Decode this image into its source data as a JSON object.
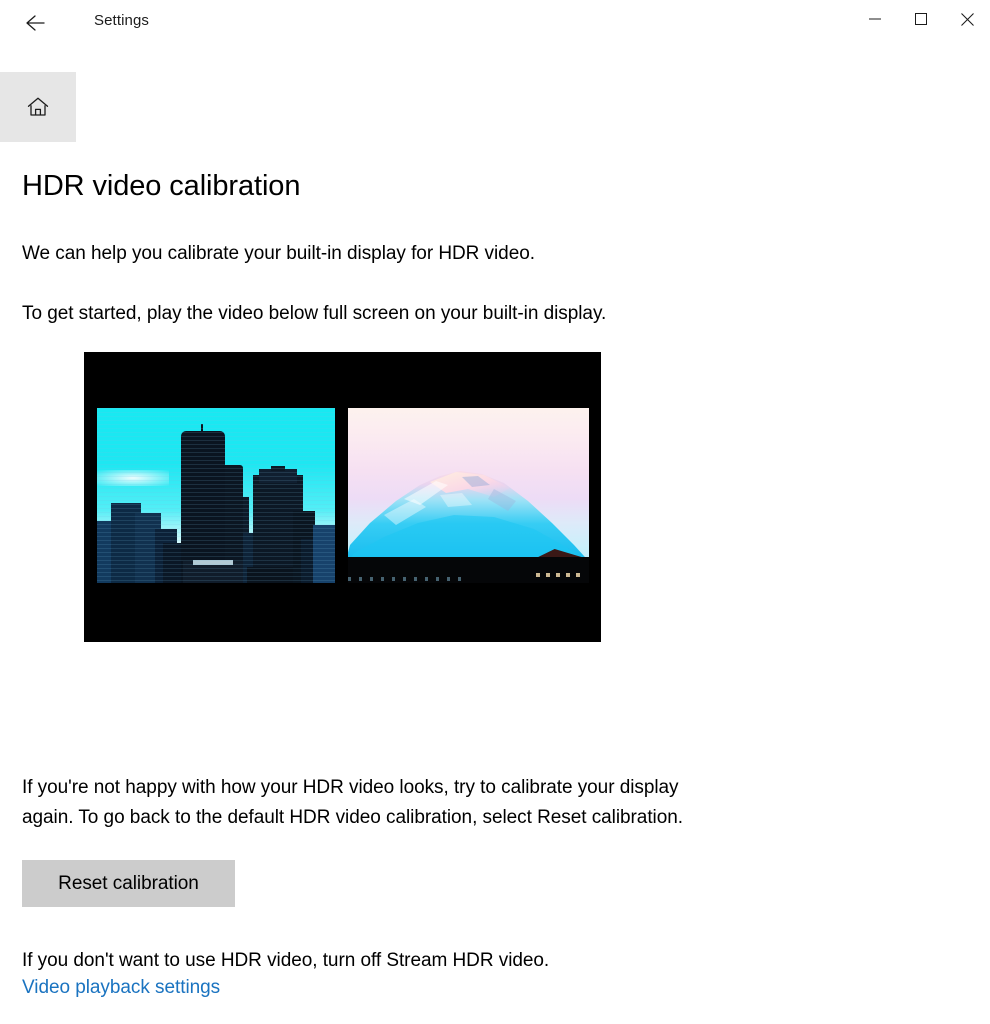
{
  "window": {
    "app_title": "Settings",
    "back_icon": "back-arrow-icon",
    "minimize_label": "—",
    "maximize_label": "□",
    "close_label": "×"
  },
  "nav": {
    "home_icon": "home-icon"
  },
  "page": {
    "title": "HDR video calibration",
    "intro": "We can help you calibrate your built-in display for HDR video.",
    "get_started": "To get started, play the video below full screen on your built-in display.",
    "unhappy": "If you're not happy with how your HDR video looks, try to calibrate your display again. To go back to the default HDR video calibration, select Reset calibration.",
    "turn_off": "If you don't want to use HDR video, turn off Stream HDR video.",
    "reset_button": "Reset calibration",
    "link": "Video playback settings"
  },
  "video": {
    "name": "hdr-calibration-video-thumbnail",
    "left_scene": "seattle-city-skyline-cyan-sky",
    "right_scene": "mount-rainier-sunrise-pink-sky"
  },
  "colors": {
    "accent_link": "#1a73c0",
    "button_fill": "#cccccc",
    "home_button_fill": "#e6e6e6",
    "video_letterbox": "#000000",
    "city_sky": "#18e9f2",
    "mountain_sky_top": "#fdf2ee",
    "mountain_snow": "#a8e8fa"
  }
}
